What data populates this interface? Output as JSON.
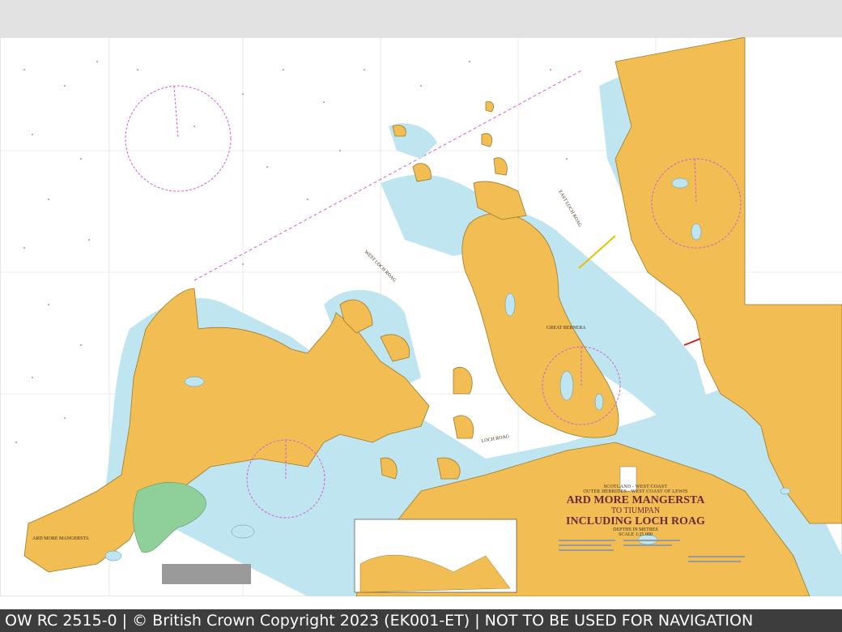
{
  "chart": {
    "title_line1": "ARD MORE MANGERSTA",
    "title_line2": "TO TIUMPAN",
    "title_line3": "INCLUDING LOCH ROAG",
    "subtitle1": "SCOTLAND - WEST COAST",
    "subtitle2": "OUTER HEBRIDES - WEST COAST OF LEWIS",
    "depths": "DEPTHS IN METRES",
    "scale": "SCALE 1:25 000"
  },
  "place_labels": {
    "great_bernera": "GREAT BERNERA",
    "east_loch_roag": "EAST LOCH ROAG",
    "west_loch_roag": "WEST LOCH ROAG",
    "loch_roag": "LOCH ROAG",
    "ard_more_mangersta": "ARD MORE MANGERSTA"
  },
  "footer": {
    "text": "OW RC 2515-0 | © British Crown Copyright 2023 (EK001-ET) | NOT TO BE USED FOR NAVIGATION"
  },
  "colors": {
    "land": "#f2bd52",
    "shallow": "#bfe6f0",
    "drying": "#8fcf9a",
    "sea": "#ffffff",
    "compass": "#d060d0",
    "footer_bg": "#3d3d3d"
  }
}
